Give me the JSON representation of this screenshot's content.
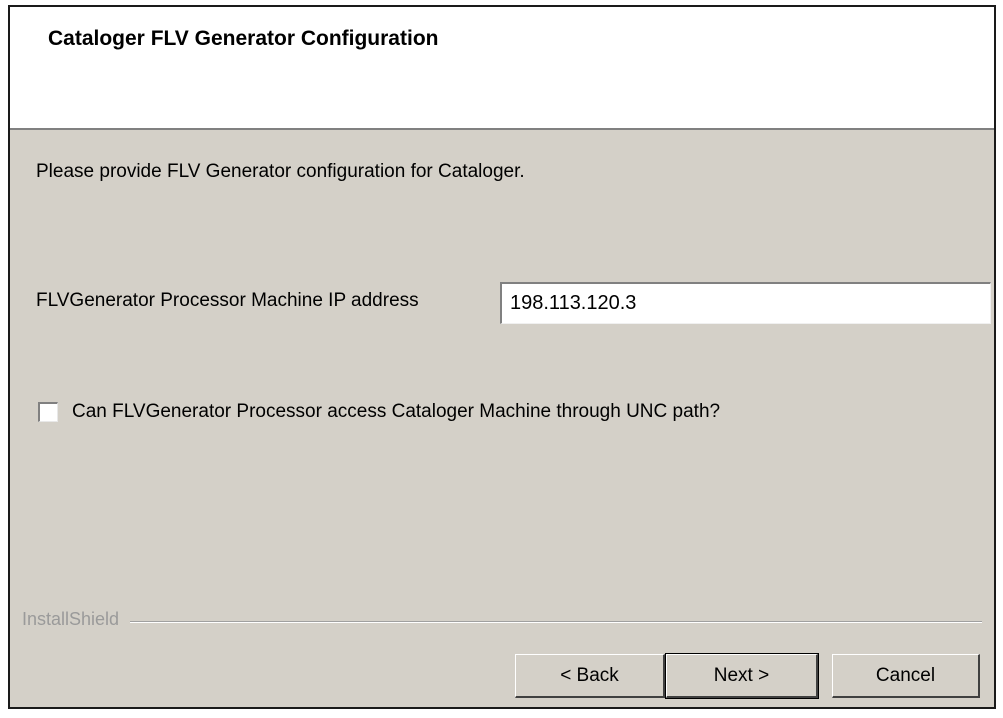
{
  "header": {
    "title": "Cataloger FLV Generator Configuration"
  },
  "body": {
    "intro": "Please provide FLV Generator configuration for Cataloger.",
    "ip_label": "FLVGenerator Processor Machine IP address",
    "ip_value": "198.113.120.3",
    "unc_checkbox_label": "Can FLVGenerator Processor access Cataloger Machine through UNC path?",
    "unc_checked": false
  },
  "footer": {
    "brand": "InstallShield",
    "back_label": "< Back",
    "next_label": "Next >",
    "cancel_label": "Cancel"
  }
}
